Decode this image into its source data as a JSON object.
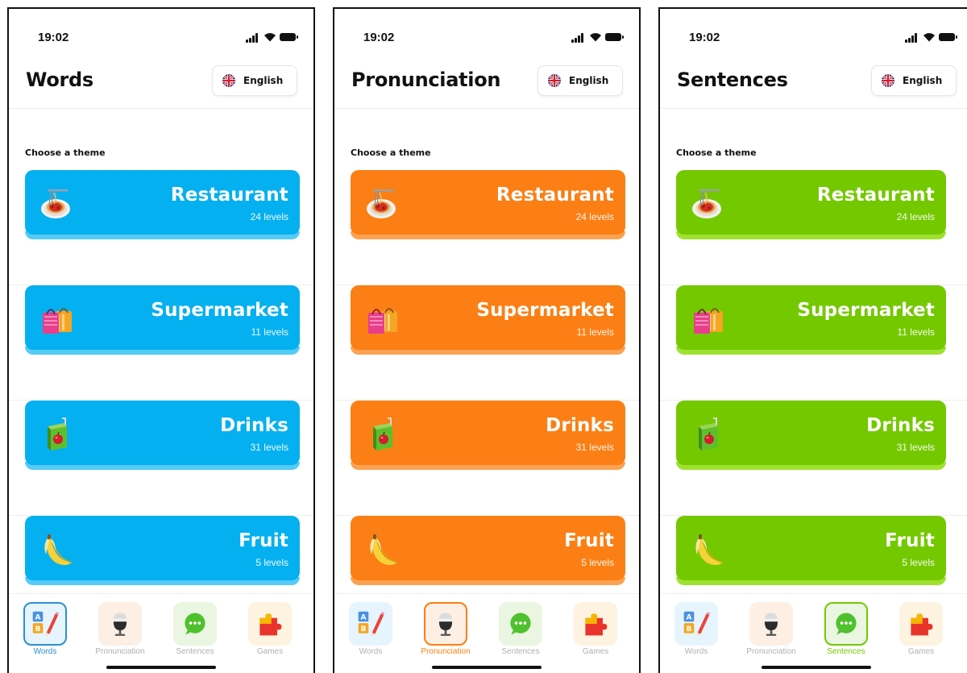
{
  "screens": [
    {
      "status_time": "19:02",
      "title": "Words",
      "language": "English",
      "section_label": "Choose a theme",
      "accent": "#05b0f0",
      "accent_shade": "#55cbf6",
      "themes": [
        {
          "name": "Restaurant",
          "levels": "24 levels",
          "icon": "spaghetti-plate-icon"
        },
        {
          "name": "Supermarket",
          "levels": "11 levels",
          "icon": "shopping-bags-icon"
        },
        {
          "name": "Drinks",
          "levels": "31 levels",
          "icon": "juice-box-icon"
        },
        {
          "name": "Fruit",
          "levels": "5 levels",
          "icon": "banana-icon"
        }
      ],
      "active_tab": "Words"
    },
    {
      "status_time": "19:02",
      "title": "Pronunciation",
      "language": "English",
      "section_label": "Choose a theme",
      "accent": "#fb7f14",
      "accent_shade": "#fca252",
      "themes": [
        {
          "name": "Restaurant",
          "levels": "24 levels",
          "icon": "spaghetti-plate-icon"
        },
        {
          "name": "Supermarket",
          "levels": "11 levels",
          "icon": "shopping-bags-icon"
        },
        {
          "name": "Drinks",
          "levels": "31 levels",
          "icon": "juice-box-icon"
        },
        {
          "name": "Fruit",
          "levels": "5 levels",
          "icon": "banana-icon"
        }
      ],
      "active_tab": "Pronunciation"
    },
    {
      "status_time": "19:02",
      "title": "Sentences",
      "language": "English",
      "section_label": "Choose a theme",
      "accent": "#74c800",
      "accent_shade": "#9ee22f",
      "themes": [
        {
          "name": "Restaurant",
          "levels": "24 levels",
          "icon": "spaghetti-plate-icon"
        },
        {
          "name": "Supermarket",
          "levels": "11 levels",
          "icon": "shopping-bags-icon"
        },
        {
          "name": "Drinks",
          "levels": "31 levels",
          "icon": "juice-box-icon"
        },
        {
          "name": "Fruit",
          "levels": "5 levels",
          "icon": "banana-icon"
        }
      ],
      "active_tab": "Sentences"
    }
  ],
  "tabs": [
    {
      "label": "Words",
      "icon": "abc-blocks-pencil-icon",
      "bg": "#e6f5fd",
      "active_color": "#2b8fd6"
    },
    {
      "label": "Pronunciation",
      "icon": "microphone-icon",
      "bg": "#fdefe4",
      "active_color": "#fb7f14"
    },
    {
      "label": "Sentences",
      "icon": "speech-bubble-icon",
      "bg": "#eaf6e1",
      "active_color": "#74c800"
    },
    {
      "label": "Games",
      "icon": "puzzle-piece-icon",
      "bg": "#fdf3e0",
      "active_color": "#e0a020"
    }
  ]
}
